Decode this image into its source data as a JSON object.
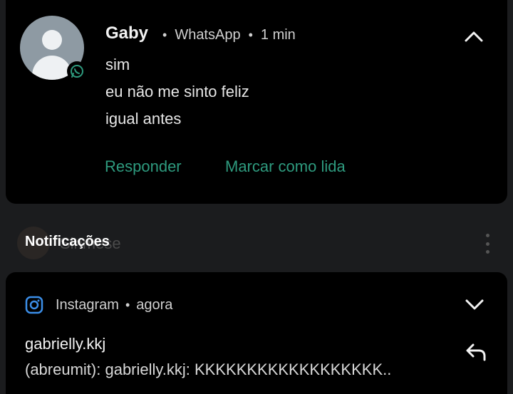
{
  "whatsapp_notification": {
    "sender": "Gaby",
    "app": "WhatsApp",
    "time": "1 min",
    "separator": "•",
    "messages": [
      "sim",
      "eu não me sinto feliz",
      "igual antes"
    ],
    "actions": {
      "reply": "Responder",
      "mark_read": "Marcar como lida"
    },
    "accent_color": "#2e9a7e",
    "icons": {
      "collapse": "chevron-up-icon",
      "badge": "whatsapp-badge-icon"
    }
  },
  "section": {
    "title": "Notificações",
    "behind_text": "Sinmese",
    "icons": {
      "menu": "more-vert-icon"
    }
  },
  "instagram_notification": {
    "app": "Instagram",
    "time": "agora",
    "separator": "•",
    "title": "gabrielly.kkj",
    "body": "(abreumit): gabrielly.kkj: KKKKKKKKKKKKKKKKKK..",
    "icons": {
      "app": "instagram-icon",
      "expand": "chevron-down-icon",
      "reply": "reply-icon"
    }
  }
}
